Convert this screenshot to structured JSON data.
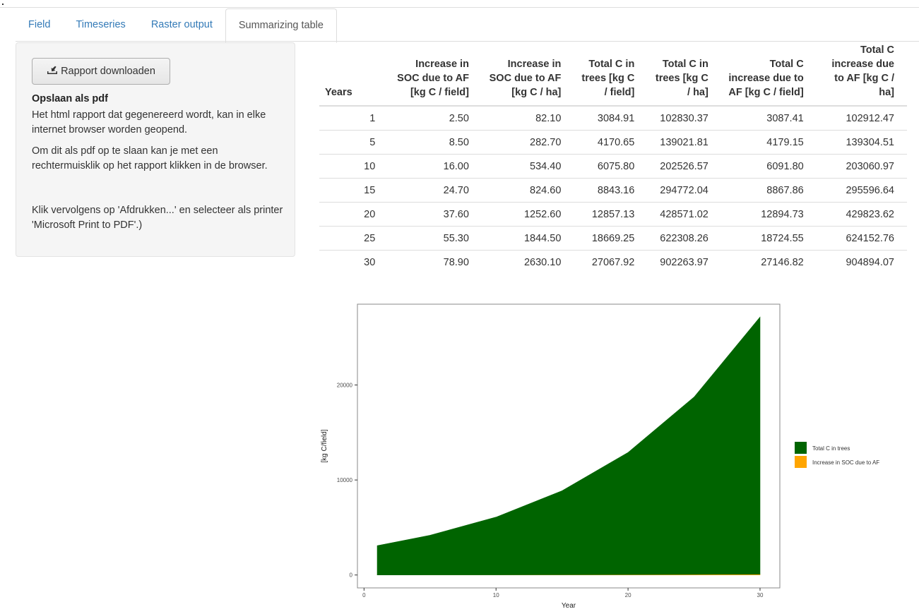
{
  "tabs": [
    {
      "label": "Field",
      "active": false
    },
    {
      "label": "Timeseries",
      "active": false
    },
    {
      "label": "Raster output",
      "active": false
    },
    {
      "label": "Summarizing table",
      "active": true
    }
  ],
  "sidebar": {
    "download_button": "Rapport downloaden",
    "download_icon": "download-icon",
    "heading": "Opslaan als pdf",
    "paragraphs": [
      "Het html rapport dat gegenereerd wordt, kan in elke internet browser worden geopend.",
      "Om dit als pdf op te slaan kan je met een rechtermuisklik op het rapport klikken in de browser.",
      "Klik vervolgens op 'Afdrukken...' en selecteer als printer 'Microsoft Print to PDF'.)"
    ]
  },
  "table": {
    "headers": [
      "Years",
      "Increase in SOC due to AF [kg C / field]",
      "Increase in SOC due to AF [kg C / ha]",
      "Total C in trees [kg C / field]",
      "Total C in trees [kg C / ha]",
      "Total C increase due to AF [kg C / field]",
      "Total C increase due to AF [kg C / ha]"
    ],
    "rows": [
      [
        "1",
        "2.50",
        "82.10",
        "3084.91",
        "102830.37",
        "3087.41",
        "102912.47"
      ],
      [
        "5",
        "8.50",
        "282.70",
        "4170.65",
        "139021.81",
        "4179.15",
        "139304.51"
      ],
      [
        "10",
        "16.00",
        "534.40",
        "6075.80",
        "202526.57",
        "6091.80",
        "203060.97"
      ],
      [
        "15",
        "24.70",
        "824.60",
        "8843.16",
        "294772.04",
        "8867.86",
        "295596.64"
      ],
      [
        "20",
        "37.60",
        "1252.60",
        "12857.13",
        "428571.02",
        "12894.73",
        "429823.62"
      ],
      [
        "25",
        "55.30",
        "1844.50",
        "18669.25",
        "622308.26",
        "18724.55",
        "624152.76"
      ],
      [
        "30",
        "78.90",
        "2630.10",
        "27067.92",
        "902263.97",
        "27146.82",
        "904894.07"
      ]
    ]
  },
  "chart_data": {
    "type": "area",
    "stacked": true,
    "x": [
      1,
      5,
      10,
      15,
      20,
      25,
      30
    ],
    "series": [
      {
        "name": "Increase in SOC due to AF",
        "color": "#FFA500",
        "values": [
          2.5,
          8.5,
          16.0,
          24.7,
          37.6,
          55.3,
          78.9
        ]
      },
      {
        "name": "Total C in trees",
        "color": "#006400",
        "values": [
          3084.91,
          4170.65,
          6075.8,
          8843.16,
          12857.13,
          18669.25,
          27067.92
        ]
      }
    ],
    "xlabel": "Year",
    "ylabel": "[kg C/field]",
    "xticks": [
      0,
      10,
      20,
      30
    ],
    "yticks": [
      0,
      10000,
      20000
    ],
    "xlim": [
      -0.5,
      31.5
    ],
    "ylim": [
      -1357,
      28504
    ],
    "legend_entries": [
      "Total C in trees",
      "Increase in SOC due to AF"
    ],
    "legend_position": "right",
    "grid": false
  }
}
